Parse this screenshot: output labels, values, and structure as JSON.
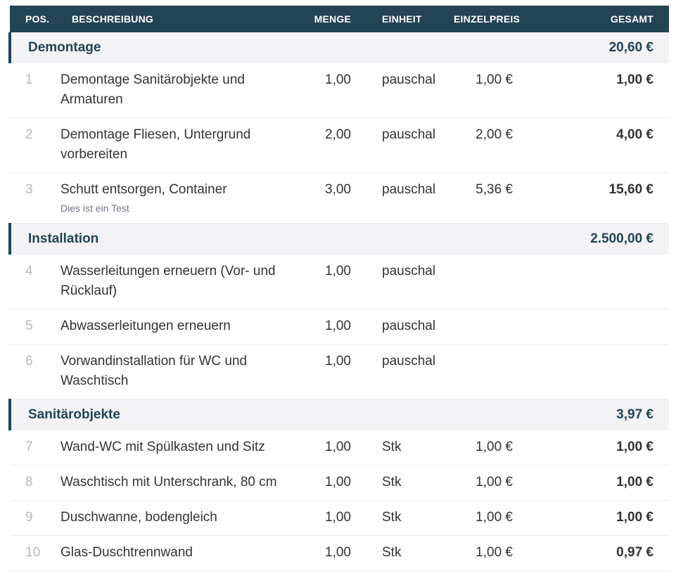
{
  "header": {
    "pos": "POS.",
    "desc": "BESCHREIBUNG",
    "qty": "MENGE",
    "unit": "EINHEIT",
    "price": "EINZELPREIS",
    "total": "GESAMT"
  },
  "groups": [
    {
      "name": "Demontage",
      "total": "20,60 €",
      "items": [
        {
          "pos": "1",
          "desc": "Demontage Sanitärobjekte und Armaturen",
          "note": "",
          "qty": "1,00",
          "unit": "pauschal",
          "price": "1,00 €",
          "total": "1,00 €"
        },
        {
          "pos": "2",
          "desc": "Demontage Fliesen, Untergrund vorbereiten",
          "note": "",
          "qty": "2,00",
          "unit": "pauschal",
          "price": "2,00 €",
          "total": "4,00 €"
        },
        {
          "pos": "3",
          "desc": "Schutt entsorgen, Container",
          "note": "Dies ist ein Test",
          "qty": "3,00",
          "unit": "pauschal",
          "price": "5,36 €",
          "total": "15,60 €"
        }
      ]
    },
    {
      "name": "Installation",
      "total": "2.500,00 €",
      "items": [
        {
          "pos": "4",
          "desc": "Wasserleitungen erneuern (Vor- und Rücklauf)",
          "note": "",
          "qty": "1,00",
          "unit": "pauschal",
          "price": "",
          "total": ""
        },
        {
          "pos": "5",
          "desc": "Abwasserleitungen erneuern",
          "note": "",
          "qty": "1,00",
          "unit": "pauschal",
          "price": "",
          "total": ""
        },
        {
          "pos": "6",
          "desc": "Vorwandinstallation für WC und Waschtisch",
          "note": "",
          "qty": "1,00",
          "unit": "pauschal",
          "price": "",
          "total": ""
        }
      ]
    },
    {
      "name": "Sanitärobjekte",
      "total": "3,97 €",
      "items": [
        {
          "pos": "7",
          "desc": "Wand-WC mit Spülkasten und Sitz",
          "note": "",
          "qty": "1,00",
          "unit": "Stk",
          "price": "1,00 €",
          "total": "1,00 €"
        },
        {
          "pos": "8",
          "desc": "Waschtisch mit Unterschrank, 80 cm",
          "note": "",
          "qty": "1,00",
          "unit": "Stk",
          "price": "1,00 €",
          "total": "1,00 €"
        },
        {
          "pos": "9",
          "desc": "Duschwanne, bodengleich",
          "note": "",
          "qty": "1,00",
          "unit": "Stk",
          "price": "1,00 €",
          "total": "1,00 €"
        },
        {
          "pos": "10",
          "desc": "Glas-Duschtrennwand",
          "note": "",
          "qty": "1,00",
          "unit": "Stk",
          "price": "1,00 €",
          "total": "0,97 €"
        }
      ]
    }
  ],
  "colors": {
    "header_bg": "#234454",
    "group_bg": "#f2f3f5",
    "accent": "#234454"
  }
}
